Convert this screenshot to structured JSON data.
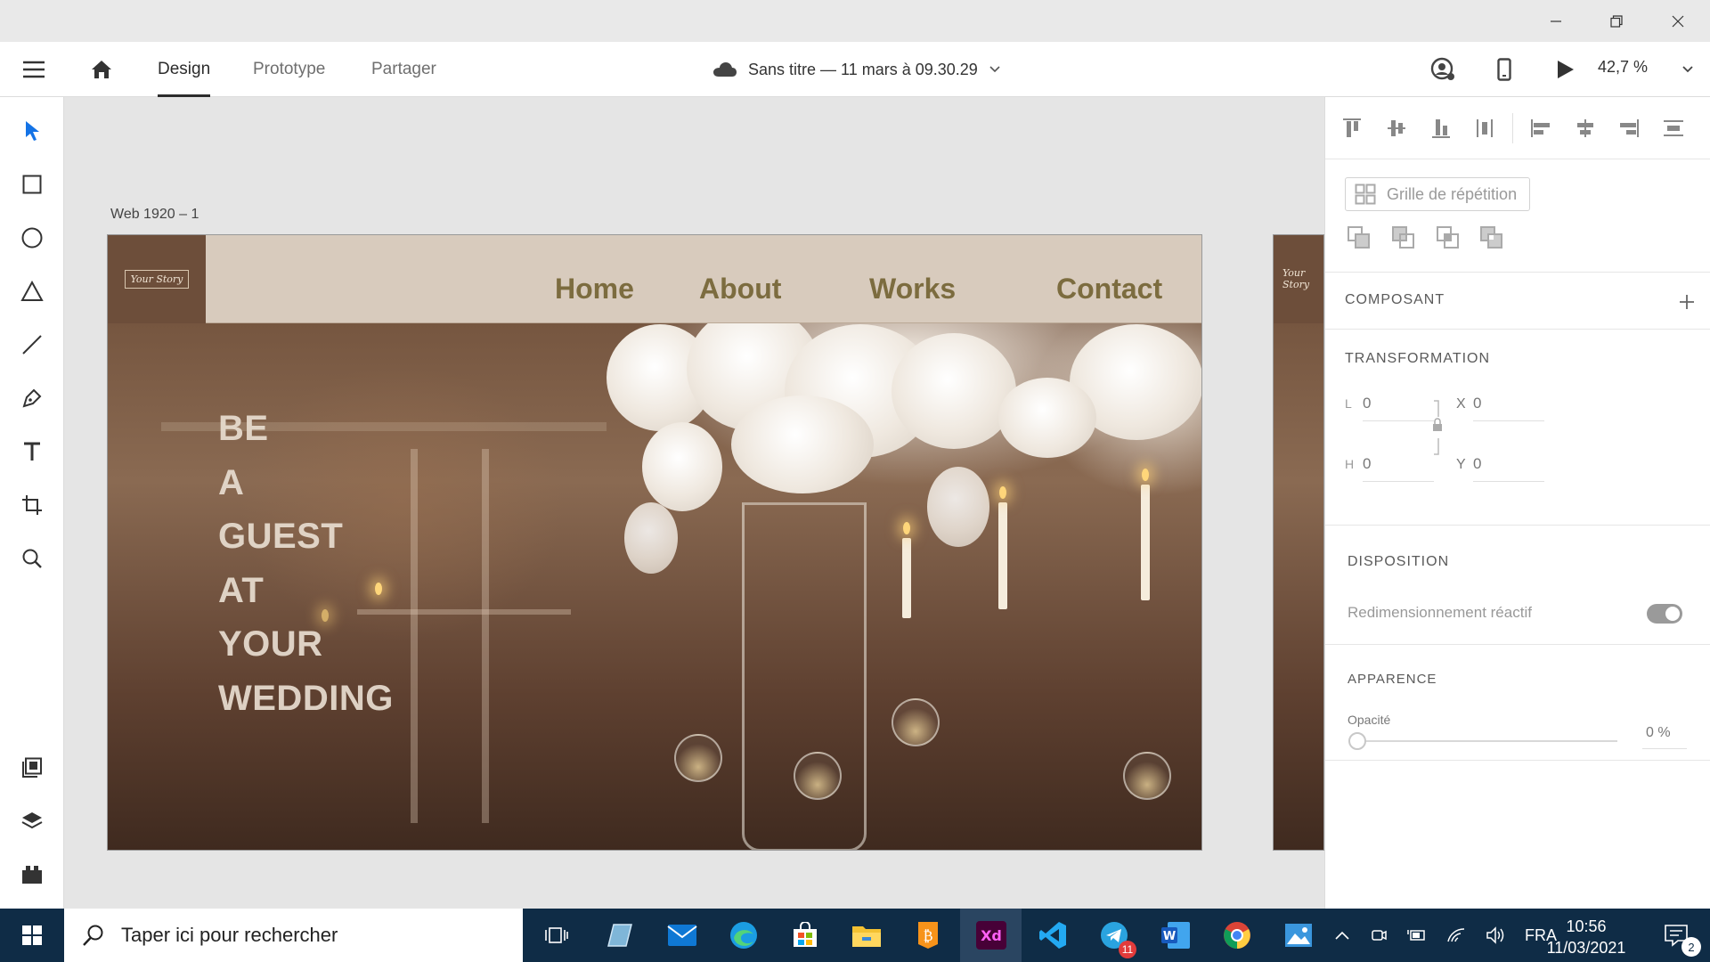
{
  "window": {
    "minimize_icon": "minimize-icon",
    "restore_icon": "restore-icon",
    "close_icon": "close-icon"
  },
  "menubar": {
    "tabs": [
      {
        "label": "Design",
        "active": true
      },
      {
        "label": "Prototype"
      },
      {
        "label": "Partager"
      }
    ],
    "document_title": "Sans titre — 11 mars à 09.30.29",
    "zoom": "42,7 %"
  },
  "canvas": {
    "artboard_label": "Web 1920 – 1",
    "site": {
      "logo_text": "Your Story",
      "nav": [
        "Home",
        "About",
        "Works",
        "Contact"
      ],
      "hero_lines": [
        "BE",
        "A",
        "GUEST",
        "AT",
        "YOUR",
        "WEDDING"
      ]
    }
  },
  "panel": {
    "repeat_grid": "Grille de répétition",
    "component": "COMPOSANT",
    "transformation": {
      "title": "TRANSFORMATION",
      "w_label": "L",
      "w_value": "0",
      "h_label": "H",
      "h_value": "0",
      "x_label": "X",
      "x_value": "0",
      "y_label": "Y",
      "y_value": "0"
    },
    "layout": {
      "title": "DISPOSITION",
      "responsive_resize": "Redimensionnement réactif",
      "responsive_on": true
    },
    "appearance": {
      "title": "APPARENCE",
      "opacity_label": "Opacité",
      "opacity_value": "0 %",
      "opacity_fraction": 0
    }
  },
  "taskbar": {
    "search_placeholder": "Taper ici pour rechercher",
    "telegram_badge": "11",
    "language": "FRA",
    "time": "10:56",
    "date": "11/03/2021",
    "notifications": "2"
  },
  "colors": {
    "accent": "#1473e6",
    "nav_text": "#7c6c3f",
    "nav_bg": "#d8cbbd",
    "taskbar": "#0f2c46",
    "xd_brand": "#470137"
  }
}
